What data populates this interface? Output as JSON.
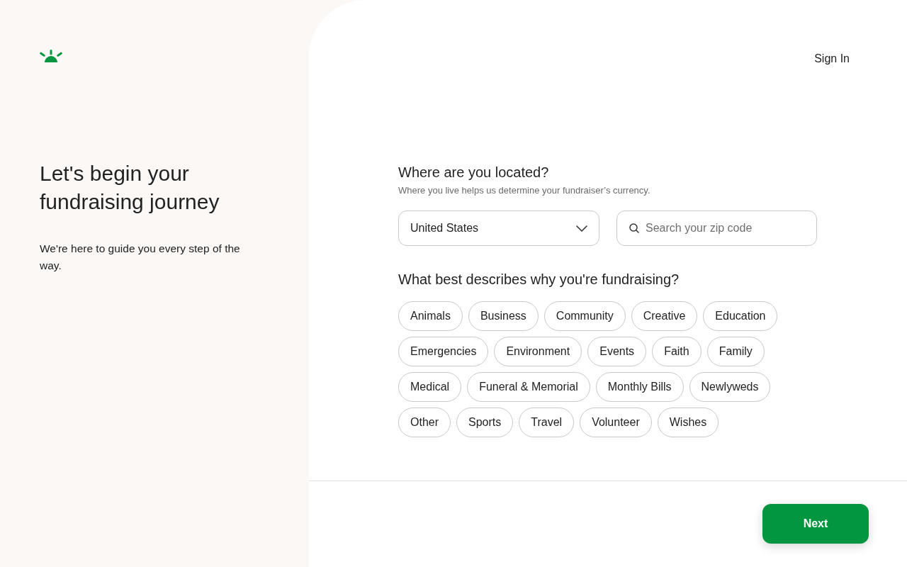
{
  "header": {
    "sign_in": "Sign In"
  },
  "intro": {
    "title": "Let's begin your fundraising journey",
    "subtitle": "We're here to guide you every step of the way."
  },
  "location": {
    "question": "Where are you located?",
    "hint": "Where you live helps us determine your fundraiser’s currency.",
    "country": {
      "value": "United States"
    },
    "zip": {
      "placeholder": "Search your zip code"
    }
  },
  "category": {
    "question": "What best describes why you're fundraising?",
    "options": [
      {
        "label": "Animals",
        "selected": false
      },
      {
        "label": "Business",
        "selected": false
      },
      {
        "label": "Community",
        "selected": false
      },
      {
        "label": "Creative",
        "selected": false
      },
      {
        "label": "Education",
        "selected": false
      },
      {
        "label": "Emergencies",
        "selected": false
      },
      {
        "label": "Environment",
        "selected": false
      },
      {
        "label": "Events",
        "selected": false
      },
      {
        "label": "Faith",
        "selected": false
      },
      {
        "label": "Family",
        "selected": false
      },
      {
        "label": "Medical",
        "selected": false
      },
      {
        "label": "Funeral & Memorial",
        "selected": false
      },
      {
        "label": "Monthly Bills",
        "selected": false
      },
      {
        "label": "Newlyweds",
        "selected": false
      },
      {
        "label": "Other",
        "selected": false
      },
      {
        "label": "Sports",
        "selected": false
      },
      {
        "label": "Travel",
        "selected": false
      },
      {
        "label": "Volunteer",
        "selected": false
      },
      {
        "label": "Wishes",
        "selected": false
      }
    ]
  },
  "footer": {
    "next_button": "Next"
  }
}
